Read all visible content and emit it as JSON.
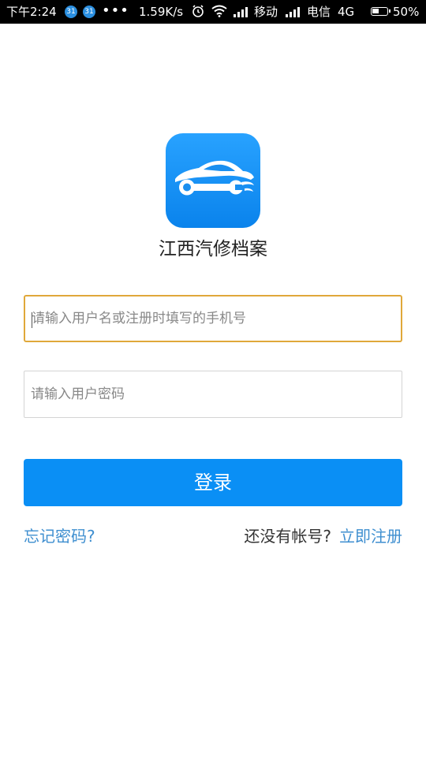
{
  "status_bar": {
    "time": "下午2:24",
    "notif_badge": "31",
    "more": "•••",
    "network_speed": "1.59K/s",
    "carrier1": "移动",
    "carrier2": "电信",
    "network_type": "4G",
    "battery": "50%",
    "icons": [
      "alarm-icon",
      "wifi-icon",
      "signal-icon",
      "battery-icon"
    ]
  },
  "app": {
    "title": "江西汽修档案",
    "logo_icon": "car-wrench-icon",
    "logo_color": "#1690f0"
  },
  "form": {
    "username_placeholder": "请输入用户名或注册时填写的手机号",
    "password_placeholder": "请输入用户密码",
    "login_label": "登录"
  },
  "links": {
    "forgot": "忘记密码?",
    "no_account": "还没有帐号?",
    "register": "立即注册"
  },
  "colors": {
    "accent": "#0a8ff5",
    "link": "#3f8fd0",
    "focus_border": "#e0a83a"
  }
}
